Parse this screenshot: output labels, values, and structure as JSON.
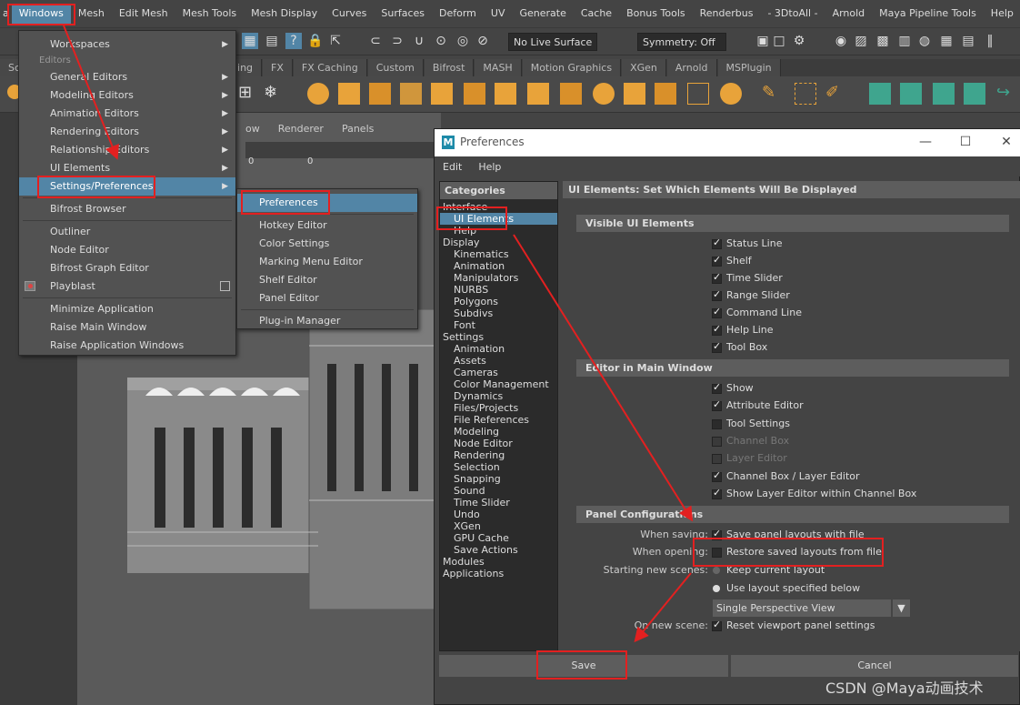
{
  "menubar": {
    "items": [
      "Windows",
      "Mesh",
      "Edit Mesh",
      "Mesh Tools",
      "Mesh Display",
      "Curves",
      "Surfaces",
      "Deform",
      "UV",
      "Generate",
      "Cache",
      "Bonus Tools",
      "Renderbus",
      "- 3DtoAll -",
      "Arnold",
      "Maya Pipeline Tools",
      "Help"
    ],
    "active_index": 0
  },
  "statusline": {
    "live_surface": "No Live Surface",
    "symmetry": "Symmetry: Off"
  },
  "shelf_tabs": [
    "Sc",
    "ing",
    "FX",
    "FX Caching",
    "Custom",
    "Bifrost",
    "MASH",
    "Motion Graphics",
    "XGen",
    "Arnold",
    "MSPlugin"
  ],
  "viewport": {
    "menu": [
      "ow",
      "Renderer",
      "Panels"
    ],
    "counters": [
      "0",
      "0"
    ]
  },
  "windows_menu": {
    "workspaces": "Workspaces",
    "editors_header": "Editors",
    "general_editors": "General Editors",
    "modeling_editors": "Modeling Editors",
    "animation_editors": "Animation Editors",
    "rendering_editors": "Rendering Editors",
    "relationship_editors": "Relationship Editors",
    "ui_elements": "UI Elements",
    "settings_preferences": "Settings/Preferences",
    "bifrost_browser": "Bifrost Browser",
    "outliner": "Outliner",
    "node_editor": "Node Editor",
    "bifrost_graph_editor": "Bifrost Graph Editor",
    "playblast": "Playblast",
    "minimize_application": "Minimize Application",
    "raise_main_window": "Raise Main Window",
    "raise_application_windows": "Raise Application Windows"
  },
  "settings_submenu": {
    "preferences": "Preferences",
    "hotkey_editor": "Hotkey Editor",
    "color_settings": "Color Settings",
    "marking_menu_editor": "Marking Menu Editor",
    "shelf_editor": "Shelf Editor",
    "panel_editor": "Panel Editor",
    "plugin_manager": "Plug-in Manager"
  },
  "prefs": {
    "title": "Preferences",
    "menu_edit": "Edit",
    "menu_help": "Help",
    "categories_header": "Categories",
    "categories": [
      {
        "label": "Interface",
        "level": 0
      },
      {
        "label": "UI Elements",
        "level": 1,
        "selected": true
      },
      {
        "label": "Help",
        "level": 1
      },
      {
        "label": "Display",
        "level": 0
      },
      {
        "label": "Kinematics",
        "level": 1
      },
      {
        "label": "Animation",
        "level": 1
      },
      {
        "label": "Manipulators",
        "level": 1
      },
      {
        "label": "NURBS",
        "level": 1
      },
      {
        "label": "Polygons",
        "level": 1
      },
      {
        "label": "Subdivs",
        "level": 1
      },
      {
        "label": "Font",
        "level": 1
      },
      {
        "label": "Settings",
        "level": 0
      },
      {
        "label": "Animation",
        "level": 1
      },
      {
        "label": "Assets",
        "level": 1
      },
      {
        "label": "Cameras",
        "level": 1
      },
      {
        "label": "Color Management",
        "level": 1
      },
      {
        "label": "Dynamics",
        "level": 1
      },
      {
        "label": "Files/Projects",
        "level": 1
      },
      {
        "label": "File References",
        "level": 1
      },
      {
        "label": "Modeling",
        "level": 1
      },
      {
        "label": "Node Editor",
        "level": 1
      },
      {
        "label": "Rendering",
        "level": 1
      },
      {
        "label": "Selection",
        "level": 1
      },
      {
        "label": "Snapping",
        "level": 1
      },
      {
        "label": "Sound",
        "level": 1
      },
      {
        "label": "Time Slider",
        "level": 1
      },
      {
        "label": "Undo",
        "level": 1
      },
      {
        "label": "XGen",
        "level": 1
      },
      {
        "label": "GPU Cache",
        "level": 1
      },
      {
        "label": "Save Actions",
        "level": 1
      },
      {
        "label": "Modules",
        "level": 0
      },
      {
        "label": "Applications",
        "level": 0
      }
    ],
    "panel_header": "UI Elements: Set Which Elements Will Be Displayed",
    "visible_ui_header": "Visible UI Elements",
    "visible_ui": [
      {
        "label": "Status Line",
        "checked": true
      },
      {
        "label": "Shelf",
        "checked": true
      },
      {
        "label": "Time Slider",
        "checked": true
      },
      {
        "label": "Range Slider",
        "checked": true
      },
      {
        "label": "Command Line",
        "checked": true
      },
      {
        "label": "Help Line",
        "checked": true
      },
      {
        "label": "Tool Box",
        "checked": true
      }
    ],
    "editor_main_header": "Editor in Main Window",
    "editor_main": [
      {
        "label": "Show",
        "checked": true,
        "disabled": false
      },
      {
        "label": "Attribute Editor",
        "checked": true,
        "disabled": false
      },
      {
        "label": "Tool Settings",
        "checked": false,
        "disabled": false
      },
      {
        "label": "Channel Box",
        "checked": false,
        "disabled": true
      },
      {
        "label": "Layer Editor",
        "checked": false,
        "disabled": true
      },
      {
        "label": "Channel Box / Layer Editor",
        "checked": true,
        "disabled": false
      },
      {
        "label": "Show Layer Editor within Channel Box",
        "checked": true,
        "disabled": false
      }
    ],
    "panel_config_header": "Panel Configurations",
    "when_saving_label": "When saving:",
    "when_saving_option": "Save panel layouts with file",
    "when_saving_checked": true,
    "when_opening_label": "When opening:",
    "when_opening_option": "Restore saved layouts from file",
    "when_opening_checked": false,
    "starting_new_label": "Starting new scenes:",
    "keep_current_layout": "Keep current layout",
    "use_layout_specified": "Use layout specified below",
    "layout_selected": "Single Perspective View",
    "on_new_scene_label": "On new scene:",
    "reset_viewport": "Reset viewport panel settings",
    "reset_viewport_checked": true,
    "save_button": "Save",
    "cancel_button": "Cancel"
  },
  "watermark": "CSDN @Maya动画技术",
  "colors": {
    "accent": "#5285a6",
    "annotation_red": "#e32020"
  }
}
